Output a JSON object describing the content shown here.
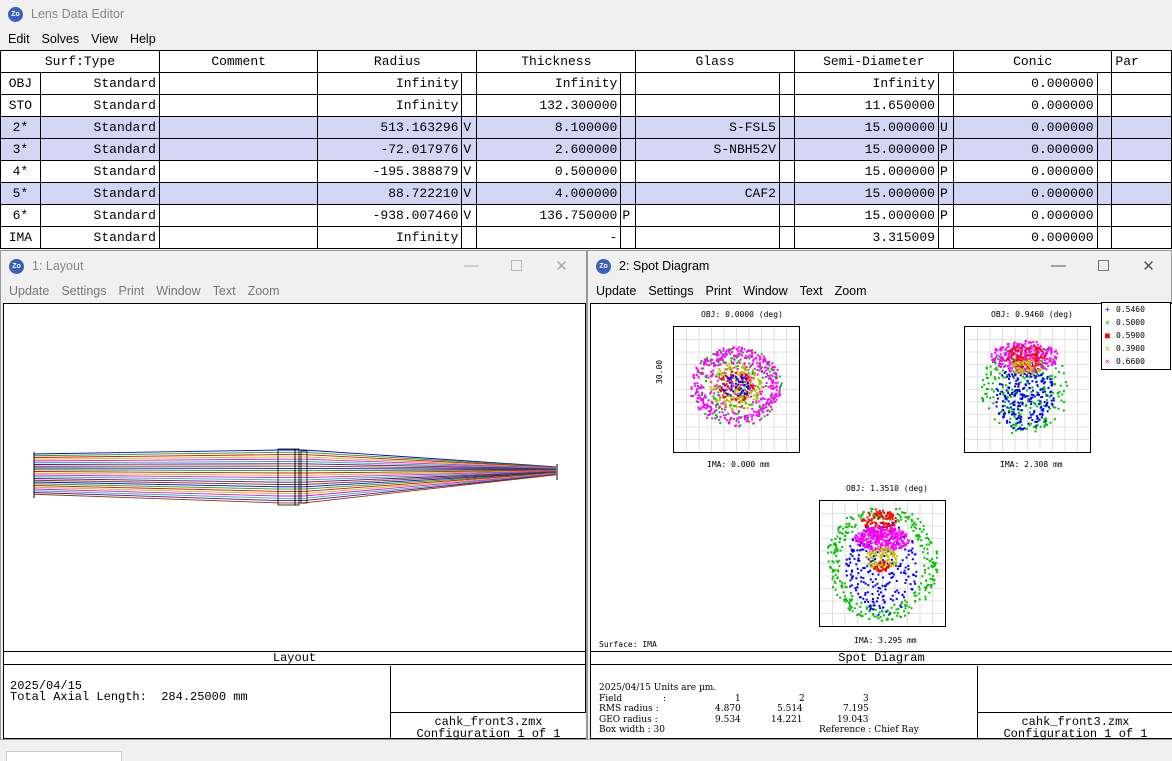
{
  "lde": {
    "title": "Lens Data Editor",
    "menu": [
      "Edit",
      "Solves",
      "View",
      "Help"
    ],
    "columns": [
      "Surf:Type",
      "Comment",
      "Radius",
      "Thickness",
      "Glass",
      "Semi-Diameter",
      "Conic",
      "Par"
    ],
    "rows": [
      {
        "surf": "OBJ",
        "type": "Standard",
        "comment": "",
        "radius": "Infinity",
        "rs": "",
        "thickness": "Infinity",
        "ts": "",
        "glass": "",
        "gs": "",
        "semi": "Infinity",
        "ss": "",
        "conic": "0.000000"
      },
      {
        "surf": "STO",
        "type": "Standard",
        "comment": "",
        "radius": "Infinity",
        "rs": "",
        "thickness": "132.300000",
        "ts": "",
        "glass": "",
        "gs": "",
        "semi": "11.650000",
        "ss": "",
        "conic": "0.000000"
      },
      {
        "surf": "2*",
        "type": "Standard",
        "comment": "",
        "radius": "513.163296",
        "rs": "V",
        "thickness": "8.100000",
        "ts": "",
        "glass": "S-FSL5",
        "gs": "",
        "semi": "15.000000",
        "ss": "U",
        "conic": "0.000000"
      },
      {
        "surf": "3*",
        "type": "Standard",
        "comment": "",
        "radius": "-72.017976",
        "rs": "V",
        "thickness": "2.600000",
        "ts": "",
        "glass": "S-NBH52V",
        "gs": "",
        "semi": "15.000000",
        "ss": "P",
        "conic": "0.000000"
      },
      {
        "surf": "4*",
        "type": "Standard",
        "comment": "",
        "radius": "-195.388879",
        "rs": "V",
        "thickness": "0.500000",
        "ts": "",
        "glass": "",
        "gs": "",
        "semi": "15.000000",
        "ss": "P",
        "conic": "0.000000"
      },
      {
        "surf": "5*",
        "type": "Standard",
        "comment": "",
        "radius": "88.722210",
        "rs": "V",
        "thickness": "4.000000",
        "ts": "",
        "glass": "CAF2",
        "gs": "",
        "semi": "15.000000",
        "ss": "P",
        "conic": "0.000000"
      },
      {
        "surf": "6*",
        "type": "Standard",
        "comment": "",
        "radius": "-938.007460",
        "rs": "V",
        "thickness": "136.750000",
        "ts": "P",
        "glass": "",
        "gs": "",
        "semi": "15.000000",
        "ss": "P",
        "conic": "0.000000"
      },
      {
        "surf": "IMA",
        "type": "Standard",
        "comment": "",
        "radius": "Infinity",
        "rs": "",
        "thickness": "-",
        "ts": "",
        "glass": "",
        "gs": "",
        "semi": "3.315009",
        "ss": "",
        "conic": "0.000000"
      }
    ],
    "highlighted_rows": [
      2,
      3,
      5
    ]
  },
  "layout_window": {
    "title": "1: Layout",
    "menu": [
      "Update",
      "Settings",
      "Print",
      "Window",
      "Text",
      "Zoom"
    ],
    "caption": "Layout",
    "info_date": "2025/04/15",
    "info_length": "Total Axial Length:  284.25000 mm",
    "file": "cahk_front3.zmx",
    "config": "Configuration 1 of 1",
    "ray_colors": [
      "#0000ff",
      "#00b000",
      "#ff0000",
      "#c0c000",
      "#ff00ff",
      "#00c0c0",
      "#800080",
      "#804000"
    ]
  },
  "spot_window": {
    "title": "2: Spot Diagram",
    "menu": [
      "Update",
      "Settings",
      "Print",
      "Window",
      "Text",
      "Zoom"
    ],
    "caption": "Spot Diagram",
    "field1_label": "OBJ: 0.0000 (deg)",
    "field2_label": "OBJ: 0.9460 (deg)",
    "field3_label": "OBJ: 1.3510 (deg)",
    "ima1": "IMA: 0.000 mm",
    "ima2": "IMA: 2.308 mm",
    "ima3": "IMA: 3.295 mm",
    "scale_label": "30.00",
    "surface_label": "Surface: IMA",
    "legend": [
      {
        "label": "0.5460",
        "color": "#0000ff",
        "glyph": "+"
      },
      {
        "label": "0.5000",
        "color": "#00c000",
        "glyph": "×"
      },
      {
        "label": "0.5900",
        "color": "#ff0000",
        "glyph": "■"
      },
      {
        "label": "0.3900",
        "color": "#c0c000",
        "glyph": "x"
      },
      {
        "label": "0.6600",
        "color": "#ff00ff",
        "glyph": "×"
      }
    ],
    "info": {
      "line1": "2025/04/15  Units are µm.",
      "field_label": "Field",
      "field_vals": [
        "1",
        "2",
        "3"
      ],
      "rms_label": "RMS radius :",
      "rms_vals": [
        "4.870",
        "5.514",
        "7.195"
      ],
      "geo_label": "GEO radius :",
      "geo_vals": [
        "9.534",
        "14.221",
        "19.043"
      ],
      "box_label": "Box width  : 30",
      "reference": "Reference  : Chief Ray"
    },
    "file": "cahk_front3.zmx",
    "config": "Configuration 1 of 1"
  }
}
